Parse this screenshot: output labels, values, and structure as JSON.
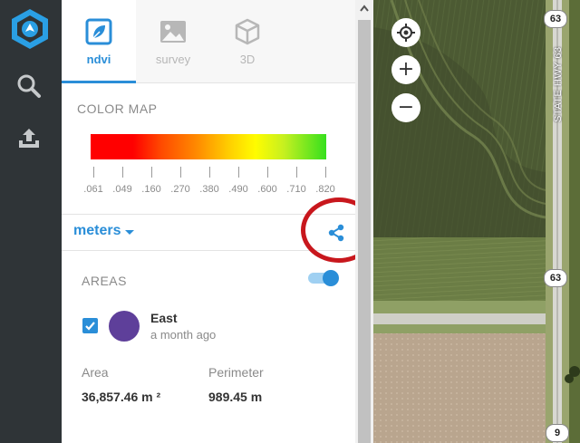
{
  "sidebar": {
    "logo_icon": "app-logo-hexagon",
    "items": [
      {
        "icon": "search-icon"
      },
      {
        "icon": "upload-icon"
      }
    ]
  },
  "tabs": [
    {
      "label": "ndvi",
      "icon": "leaf-icon",
      "active": true
    },
    {
      "label": "survey",
      "icon": "image-icon",
      "active": false
    },
    {
      "label": "3D",
      "icon": "cube-icon",
      "active": false
    }
  ],
  "color_map": {
    "title": "COLOR MAP",
    "ticks": [
      ".061",
      ".049",
      ".160",
      ".270",
      ".380",
      ".490",
      ".600",
      ".710",
      ".820"
    ]
  },
  "units": {
    "label": "meters",
    "share_icon": "share-icon"
  },
  "areas": {
    "title": "AREAS",
    "toggle_on": true,
    "items": [
      {
        "name": "East",
        "time": "a month ago",
        "checked": true,
        "color": "#5e3f9a"
      }
    ],
    "stats": {
      "area_label": "Area",
      "area_value": "36,857.46 m ²",
      "perimeter_label": "Perimeter",
      "perimeter_value": "989.45 m"
    }
  },
  "map": {
    "controls": [
      {
        "icon": "locate-icon"
      },
      {
        "label": "+"
      },
      {
        "label": "−"
      }
    ],
    "shields": [
      "63",
      "63",
      "9"
    ],
    "road_label": "STATE HWY 63"
  },
  "colors": {
    "accent": "#2a8ed8",
    "rail": "#2f3437",
    "highlight": "#c8171d"
  }
}
